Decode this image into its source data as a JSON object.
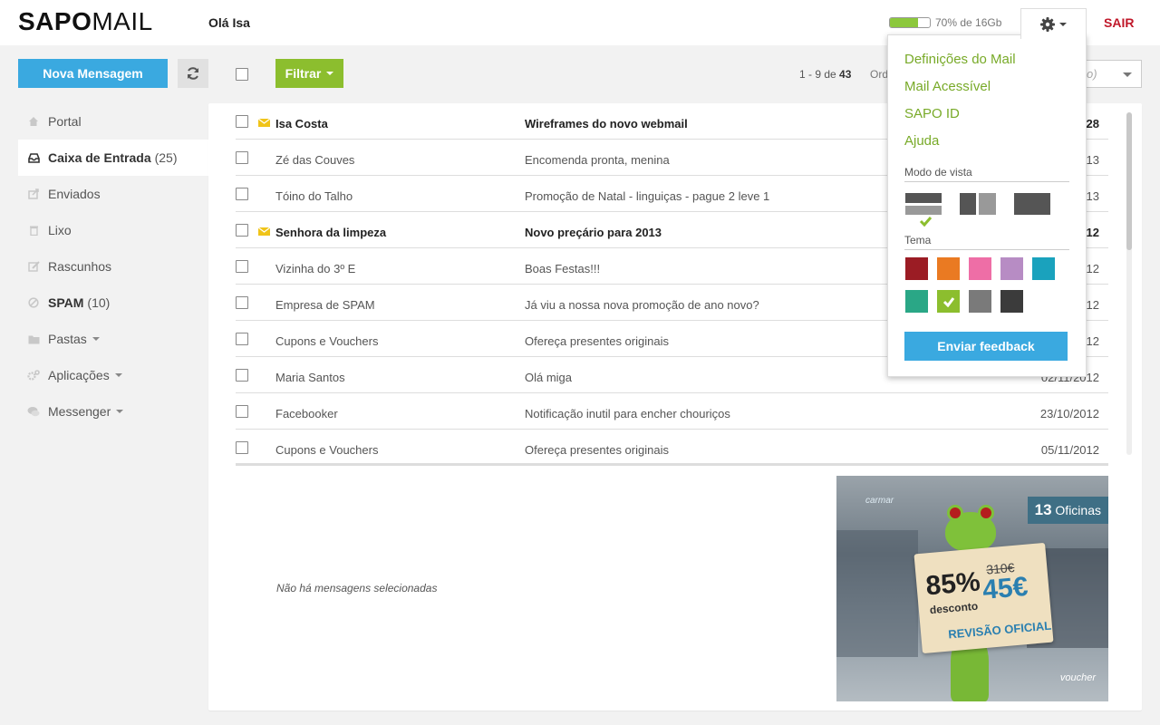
{
  "header": {
    "logo_bold": "SAPO",
    "logo_light": "MAIL",
    "greeting": "Olá Isa",
    "quota_text": "70% de 16Gb",
    "quota_fraction": 0.7,
    "logout_label": "SAIR"
  },
  "toolbar": {
    "new_message_label": "Nova Mensagem",
    "filter_label": "Filtrar",
    "pager_range": "1 - 9 de",
    "pager_total": "43",
    "order_label": "Ord",
    "order_value": "o)"
  },
  "sidebar": {
    "items": [
      {
        "label": "Portal",
        "count": "",
        "icon": "home-icon"
      },
      {
        "label": "Caixa de Entrada",
        "count": "(25)",
        "icon": "inbox-icon"
      },
      {
        "label": "Enviados",
        "count": "",
        "icon": "sent-icon"
      },
      {
        "label": "Lixo",
        "count": "",
        "icon": "trash-icon"
      },
      {
        "label": "Rascunhos",
        "count": "",
        "icon": "draft-icon"
      },
      {
        "label": "SPAM",
        "count": "(10)",
        "icon": "spam-icon"
      },
      {
        "label": "Pastas",
        "count": "",
        "icon": "folder-icon"
      },
      {
        "label": "Aplicações",
        "count": "",
        "icon": "apps-icon"
      },
      {
        "label": "Messenger",
        "count": "",
        "icon": "chat-icon"
      }
    ]
  },
  "mails": [
    {
      "sender": "Isa Costa",
      "subject": "Wireframes do novo webmail",
      "date": "28",
      "unread": true
    },
    {
      "sender": "Zé das Couves",
      "subject": "Encomenda pronta, menina",
      "date": "13",
      "unread": false
    },
    {
      "sender": "Tóino do Talho",
      "subject": "Promoção de Natal - linguiças - pague 2 leve 1",
      "date": "13",
      "unread": false
    },
    {
      "sender": "Senhora da limpeza",
      "subject": "Novo preçário para 2013",
      "date": "12",
      "unread": true
    },
    {
      "sender": "Vizinha do 3º E",
      "subject": "Boas Festas!!!",
      "date": "12",
      "unread": false
    },
    {
      "sender": "Empresa de SPAM",
      "subject": "Já viu a nossa nova promoção de ano novo?",
      "date": "12",
      "unread": false
    },
    {
      "sender": "Cupons e Vouchers",
      "subject": "Ofereça presentes originais",
      "date": "12",
      "unread": false
    },
    {
      "sender": "Maria Santos",
      "subject": "Olá miga",
      "date": "02/11/2012",
      "unread": false
    },
    {
      "sender": "Facebooker",
      "subject": "Notificação inutil para encher chouriços",
      "date": "23/10/2012",
      "unread": false
    },
    {
      "sender": "Cupons e Vouchers",
      "subject": "Ofereça presentes originais",
      "date": "05/11/2012",
      "unread": false
    }
  ],
  "preview": {
    "empty_text": "Não há mensagens selecionadas"
  },
  "ad": {
    "brand": "carmar",
    "badge_number": "13",
    "badge_text": "Oficinas",
    "percent": "85%",
    "discount_label": "desconto",
    "old_price": "310€",
    "new_price": "45€",
    "service": "REVISÃO OFICIAL",
    "voucher": "voucher"
  },
  "settings": {
    "links": [
      "Definições do Mail",
      "Mail Acessível",
      "SAPO ID",
      "Ajuda"
    ],
    "view_mode_label": "Modo de vista",
    "theme_label": "Tema",
    "themes": [
      "#9b1c24",
      "#ea7a22",
      "#ee6ea6",
      "#b78cc4",
      "#1aa2bd",
      "#2aa786",
      "#8cbe2e",
      "#7a7a7a",
      "#3b3b3b"
    ],
    "selected_theme": 6,
    "feedback_label": "Enviar feedback"
  }
}
